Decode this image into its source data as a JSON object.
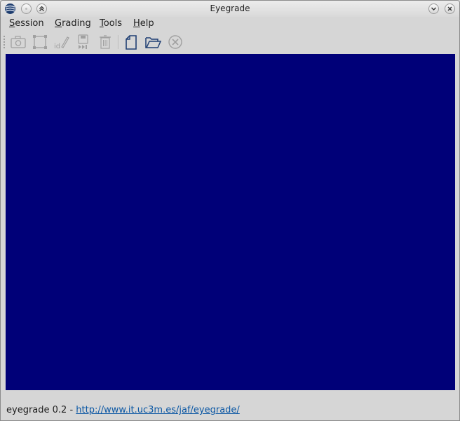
{
  "window": {
    "title": "Eyegrade"
  },
  "menubar": {
    "items": [
      {
        "mnemonic": "S",
        "rest": "ession"
      },
      {
        "mnemonic": "G",
        "rest": "rading"
      },
      {
        "mnemonic": "T",
        "rest": "ools"
      },
      {
        "mnemonic": "H",
        "rest": "elp"
      }
    ]
  },
  "toolbar": {
    "icons": [
      "camera-icon",
      "frame-icon",
      "edit-id-icon",
      "save-next-icon",
      "discard-icon",
      "new-session-icon",
      "open-session-icon",
      "close-session-icon"
    ],
    "id_glyph": "id"
  },
  "viewport": {
    "background": "#000078"
  },
  "status": {
    "prefix": "eyegrade 0.2 - ",
    "link": "http://www.it.uc3m.es/jaf/eyegrade/"
  },
  "colors": {
    "link": "#0b57a4",
    "icon_active": "#1f3f73",
    "icon_disabled": "#a0a0a0"
  }
}
